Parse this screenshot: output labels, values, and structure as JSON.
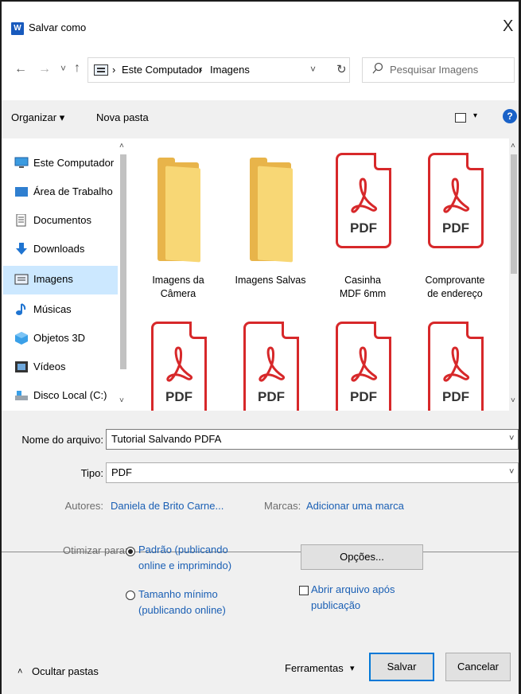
{
  "window": {
    "title": "Salvar como",
    "app_icon": "W",
    "close_glyph": "X"
  },
  "nav": {
    "back_glyph": "←",
    "forward_glyph": "→",
    "recent_glyph": "˅",
    "up_glyph": "↑",
    "breadcrumb": [
      "Este Computador",
      "Imagens"
    ],
    "separator": "›",
    "dropdown_glyph": "˅",
    "refresh_glyph": "↻",
    "search_placeholder": "Pesquisar Imagens"
  },
  "toolbar": {
    "organize_label": "Organizar ▾",
    "new_folder_label": "Nova pasta",
    "view_caret": "▾",
    "help_label": "?"
  },
  "sidebar": {
    "items": [
      {
        "label": "Este Computador",
        "icon": "computer-icon"
      },
      {
        "label": "Área de Trabalho",
        "icon": "desktop-icon"
      },
      {
        "label": "Documentos",
        "icon": "documents-icon"
      },
      {
        "label": "Downloads",
        "icon": "downloads-icon"
      },
      {
        "label": "Imagens",
        "icon": "pictures-icon",
        "selected": true
      },
      {
        "label": "Músicas",
        "icon": "music-icon"
      },
      {
        "label": "Objetos 3D",
        "icon": "objects-3d-icon"
      },
      {
        "label": "Vídeos",
        "icon": "videos-icon"
      },
      {
        "label": "Disco Local (C:)",
        "icon": "drive-icon"
      }
    ],
    "scroll_up": "˄",
    "scroll_down": "˅"
  },
  "files": [
    {
      "name": "Imagens da Câmera",
      "type": "folder"
    },
    {
      "name": "Imagens Salvas",
      "type": "folder"
    },
    {
      "name": "Casinha MDF 6mm",
      "type": "pdf"
    },
    {
      "name": "Comprovante de endereço",
      "type": "pdf"
    },
    {
      "name": "",
      "type": "pdf"
    },
    {
      "name": "",
      "type": "pdf"
    },
    {
      "name": "",
      "type": "pdf"
    },
    {
      "name": "",
      "type": "pdf"
    }
  ],
  "pdf_text": "PDF",
  "form": {
    "filename_label": "Nome do arquivo:",
    "filename_value": "Tutorial Salvando PDFA",
    "type_label": "Tipo:",
    "type_value": "PDF",
    "authors_label": "Autores:",
    "authors_value": "Daniela de Brito Carne...",
    "tags_label": "Marcas:",
    "tags_value": "Adicionar uma marca",
    "optimize_label": "Otimizar para:",
    "opt_standard": "Padrão (publicando online e imprimindo)",
    "opt_standard_l1": "Padrão (publicando",
    "opt_standard_l2": "online e imprimindo)",
    "opt_minimum_l1": "Tamanho mínimo",
    "opt_minimum_l2": "(publicando online)",
    "options_button": "Opções...",
    "open_after_l1": "Abrir arquivo após",
    "open_after_l2": "publicação",
    "chevron": "˅"
  },
  "footer": {
    "hide_folders": "Ocultar pastas",
    "hide_glyph": "˄",
    "tools_label": "Ferramentas",
    "tools_caret": "▾",
    "save_label": "Salvar",
    "cancel_label": "Cancelar"
  },
  "colors": {
    "accent": "#0078d7",
    "link": "#1a5fb4",
    "pdf_red": "#d7282a",
    "selection": "#cce8ff",
    "folder": "#f8d775"
  }
}
